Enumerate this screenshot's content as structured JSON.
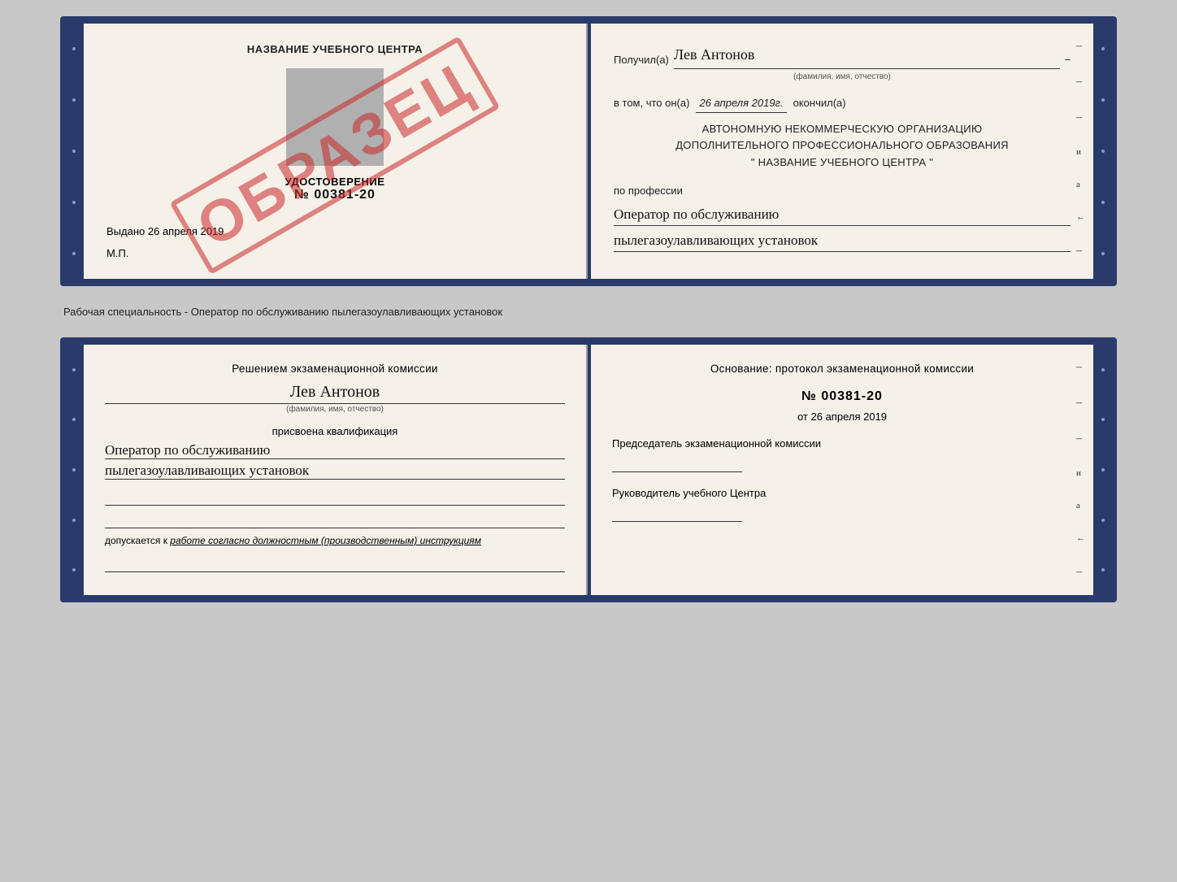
{
  "background": "#c8c8c8",
  "top_cert": {
    "left_page": {
      "title": "НАЗВАНИЕ УЧЕБНОГО ЦЕНТРА",
      "udostoverenie_label": "УДОСТОВЕРЕНИЕ",
      "number": "№ 00381-20",
      "vydano_label": "Выдано",
      "vydano_date": "26 апреля 2019",
      "mp_label": "М.П.",
      "obrazec": "ОБРАЗЕЦ"
    },
    "right_page": {
      "poluchil_label": "Получил(а)",
      "poluchil_name": "Лев Антонов",
      "fio_hint": "(фамилия, имя, отчество)",
      "vtom_label": "в том, что он(а)",
      "vtom_date": "26 апреля 2019г.",
      "okonchil_label": "окончил(а)",
      "org_line1": "АВТОНОМНУЮ НЕКОММЕРЧЕСКУЮ ОРГАНИЗАЦИЮ",
      "org_line2": "ДОПОЛНИТЕЛЬНОГО ПРОФЕССИОНАЛЬНОГО ОБРАЗОВАНИЯ",
      "org_line3": "\"   НАЗВАНИЕ УЧЕБНОГО ЦЕНТРА   \"",
      "professiya_label": "по профессии",
      "professiya_line1": "Оператор по обслуживанию",
      "professiya_line2": "пылегазоулавливающих установок",
      "dashes": [
        "-",
        "-",
        "-",
        "и",
        "а",
        "←",
        "-",
        "-",
        "-",
        "-"
      ]
    }
  },
  "separator": "Рабочая специальность - Оператор по обслуживанию пылегазоулавливающих установок",
  "bottom_cert": {
    "left_page": {
      "resheniem_label": "Решением экзаменационной комиссии",
      "fio_name": "Лев Антонов",
      "fio_hint": "(фамилия, имя, отчество)",
      "prisvoena_label": "присвоена квалификация",
      "kvali_line1": "Оператор по обслуживанию",
      "kvali_line2": "пылегазоулавливающих установок",
      "dopuskaetsya_prefix": "допускается к",
      "dopuskaetsya_text": "работе согласно должностным (производственным) инструкциям"
    },
    "right_page": {
      "osnovanie_label": "Основание: протокол экзаменационной комиссии",
      "number": "№ 00381-20",
      "ot_label": "от",
      "ot_date": "26 апреля 2019",
      "predsedatel_label": "Председатель экзаменационной комиссии",
      "rukovoditel_label": "Руководитель учебного Центра",
      "dashes": [
        "-",
        "-",
        "-",
        "и",
        "а",
        "←",
        "-",
        "-"
      ]
    }
  }
}
